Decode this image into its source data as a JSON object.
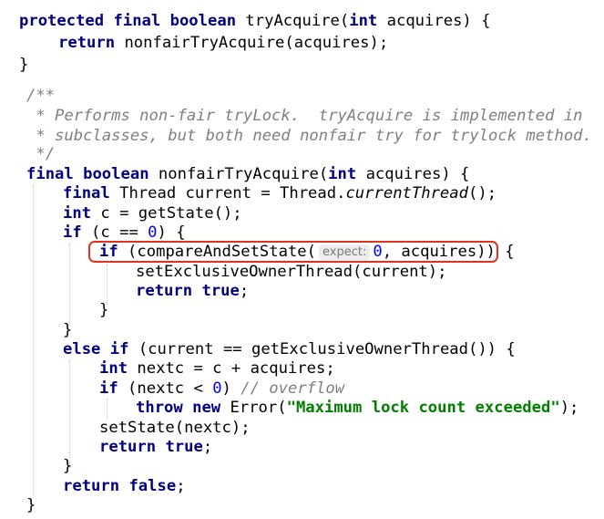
{
  "code": {
    "l1": {
      "kw1": "protected",
      "kw2": "final",
      "kw3": "boolean",
      "name": "tryAcquire(",
      "kw4": "int",
      "rest": " acquires) {"
    },
    "l2": {
      "kw": "return",
      "rest": " nonfairTryAcquire(acquires);"
    },
    "l3": {
      "text": "}"
    },
    "l4": {
      "text": "/**"
    },
    "l5": {
      "text": " * Performs non-fair tryLock.  tryAcquire is implemented in"
    },
    "l6": {
      "text": " * subclasses, but both need nonfair try for trylock method."
    },
    "l7": {
      "text": " */"
    },
    "l8": {
      "kw1": "final",
      "kw2": "boolean",
      "name": "nonfairTryAcquire(",
      "kw3": "int",
      "rest": " acquires) {"
    },
    "l9": {
      "kw": "final",
      "a": " Thread current = Thread.",
      "it": "currentThread",
      "b": "();"
    },
    "l10": {
      "kw": "int",
      "rest": " c = getState();"
    },
    "l11": {
      "kw": "if",
      "a": " (c == ",
      "num": "0",
      "b": ") {"
    },
    "l12": {
      "kw": "if",
      "a": " (compareAndSetState(",
      "hint": "expect:",
      "num": "0",
      "b": ", acquires)) {"
    },
    "l13": {
      "text": "setExclusiveOwnerThread(current);"
    },
    "l14": {
      "kw1": "return",
      "kw2": "true",
      "rest": ";"
    },
    "l15": {
      "text": "}"
    },
    "l16": {
      "text": "}"
    },
    "l17": {
      "kw1": "else",
      "kw2": "if",
      "rest": " (current == getExclusiveOwnerThread()) {"
    },
    "l18": {
      "kw": "int",
      "rest": " nextc = c + acquires;"
    },
    "l19": {
      "kw": "if",
      "a": " (nextc < ",
      "num": "0",
      "b": ") ",
      "cmt": "// overflow"
    },
    "l20": {
      "kw1": "throw",
      "kw2": "new",
      "a": " Error(",
      "str": "\"Maximum lock count exceeded\"",
      "b": ");"
    },
    "l21": {
      "text": "setState(nextc);"
    },
    "l22": {
      "kw1": "return",
      "kw2": "true",
      "rest": ";"
    },
    "l23": {
      "text": "}"
    },
    "l24": {
      "kw1": "return",
      "kw2": "false",
      "rest": ";"
    },
    "l25": {
      "text": "}"
    }
  },
  "colors": {
    "keyword": "#000080",
    "number": "#0000ff",
    "string": "#008000",
    "comment": "#808080",
    "highlight_box": "#e3311d"
  }
}
